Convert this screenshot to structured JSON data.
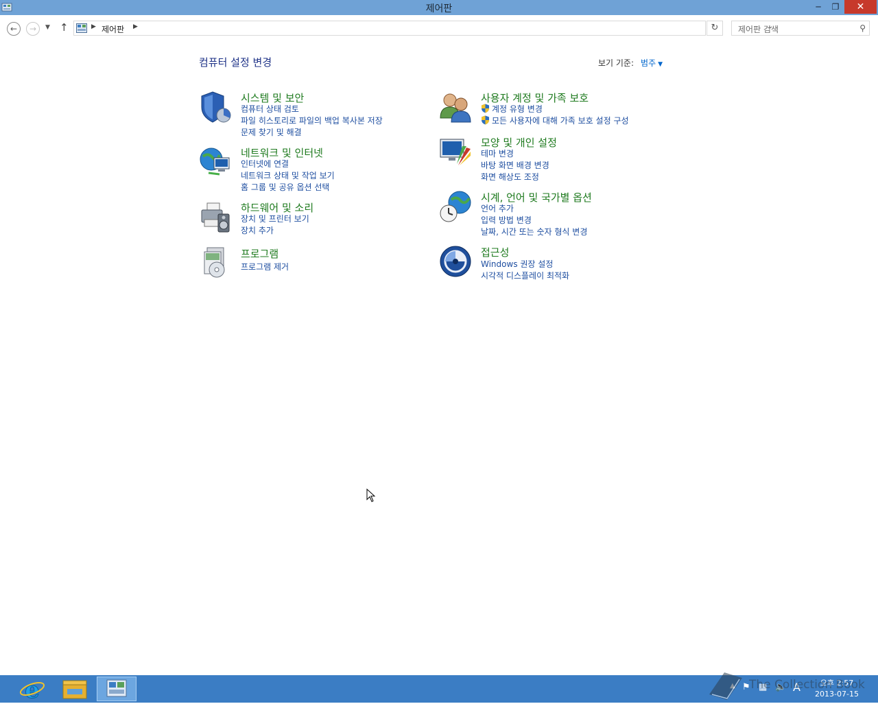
{
  "window": {
    "title": "제어판"
  },
  "addressbar": {
    "crumb": "제어판",
    "search_placeholder": "제어판 검색"
  },
  "content": {
    "page_title": "컴퓨터 설정 변경",
    "viewby_label": "보기 기준:",
    "viewby_value": "범주"
  },
  "categories": [
    {
      "id": "system-security",
      "heading": "시스템 및 보안",
      "icon": "shield-icon",
      "links": [
        "컴퓨터 상태 검토",
        "파일 히스토리로 파일의 백업 복사본 저장",
        "문제 찾기 및 해결"
      ]
    },
    {
      "id": "network",
      "heading": "네트워크 및 인터넷",
      "icon": "network-globe-icon",
      "links": [
        "인터넷에 연결",
        "네트워크 상태 및 작업 보기",
        "홈 그룹 및 공유 옵션 선택"
      ]
    },
    {
      "id": "hardware-sound",
      "heading": "하드웨어 및 소리",
      "icon": "printer-speaker-icon",
      "links": [
        "장치 및 프린터 보기",
        "장치 추가"
      ]
    },
    {
      "id": "programs",
      "heading": "프로그램",
      "icon": "programs-disc-icon",
      "links": [
        "프로그램 제거"
      ]
    },
    {
      "id": "user-accounts",
      "heading": "사용자 계정 및 가족 보호",
      "icon": "users-icon",
      "links": [
        "계정 유형 변경",
        "모든 사용자에 대해 가족 보호 설정 구성"
      ]
    },
    {
      "id": "appearance",
      "heading": "모양 및 개인 설정",
      "icon": "monitor-palette-icon",
      "links": [
        "테마 변경",
        "바탕 화면 배경 변경",
        "화면 해상도 조정"
      ]
    },
    {
      "id": "clock-region",
      "heading": "시계, 언어 및 국가별 옵션",
      "icon": "clock-globe-icon",
      "links": [
        "언어 추가",
        "입력 방법 변경",
        "날짜, 시간 또는 숫자 형식 변경"
      ]
    },
    {
      "id": "accessibility",
      "heading": "접근성",
      "icon": "accessibility-icon",
      "links": [
        "Windows 권장 설정",
        "시각적 디스플레이 최적화"
      ]
    }
  ],
  "taskbar": {
    "clock_time": "오후 2:57",
    "clock_date": "2013-07-15",
    "ime": "A",
    "watermark": "The Collection Book"
  },
  "colors": {
    "titlebar": "#6fa2d6",
    "taskbar": "#3b7dc4",
    "heading_green": "#1e7a1e",
    "link_blue": "#1e4ea0"
  }
}
